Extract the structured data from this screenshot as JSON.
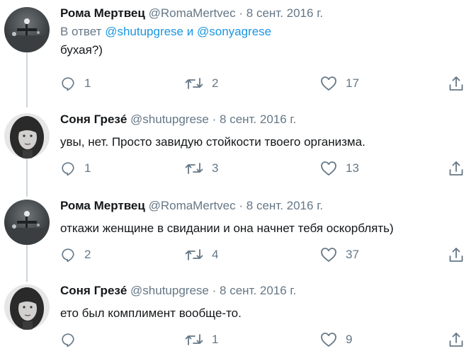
{
  "tweets": [
    {
      "name": "Рома Мертвец",
      "handle": "@RomaMertvec",
      "separator": "·",
      "date": "8 сент. 2016 г.",
      "reply_prefix": "В ответ",
      "reply_to_1": "@shutupgrese",
      "reply_and": "и",
      "reply_to_2": "@sonyagrese",
      "text": "бухая?)",
      "replies": "1",
      "retweets": "2",
      "likes": "17"
    },
    {
      "name": "Соня Грезé",
      "handle": "@shutupgrese",
      "separator": "·",
      "date": "8 сент. 2016 г.",
      "text": "увы, нет. Просто завидую стойкости твоего организма.",
      "replies": "1",
      "retweets": "3",
      "likes": "13"
    },
    {
      "name": "Рома Мертвец",
      "handle": "@RomaMertvec",
      "separator": "·",
      "date": "8 сент. 2016 г.",
      "text": "откажи женщине в свидании и она начнет тебя оскорблять)",
      "replies": "2",
      "retweets": "4",
      "likes": "37"
    },
    {
      "name": "Соня Грезé",
      "handle": "@shutupgrese",
      "separator": "·",
      "date": "8 сент. 2016 г.",
      "text": "ето был комплимент вообще-то.",
      "replies": "",
      "retweets": "1",
      "likes": "9"
    }
  ],
  "icons": {
    "reply": "reply-icon",
    "retweet": "retweet-icon",
    "like": "heart-icon",
    "share": "share-icon"
  },
  "colors": {
    "link": "#1b95e0",
    "muted": "#657786",
    "thread_line": "#ccd6dd"
  }
}
